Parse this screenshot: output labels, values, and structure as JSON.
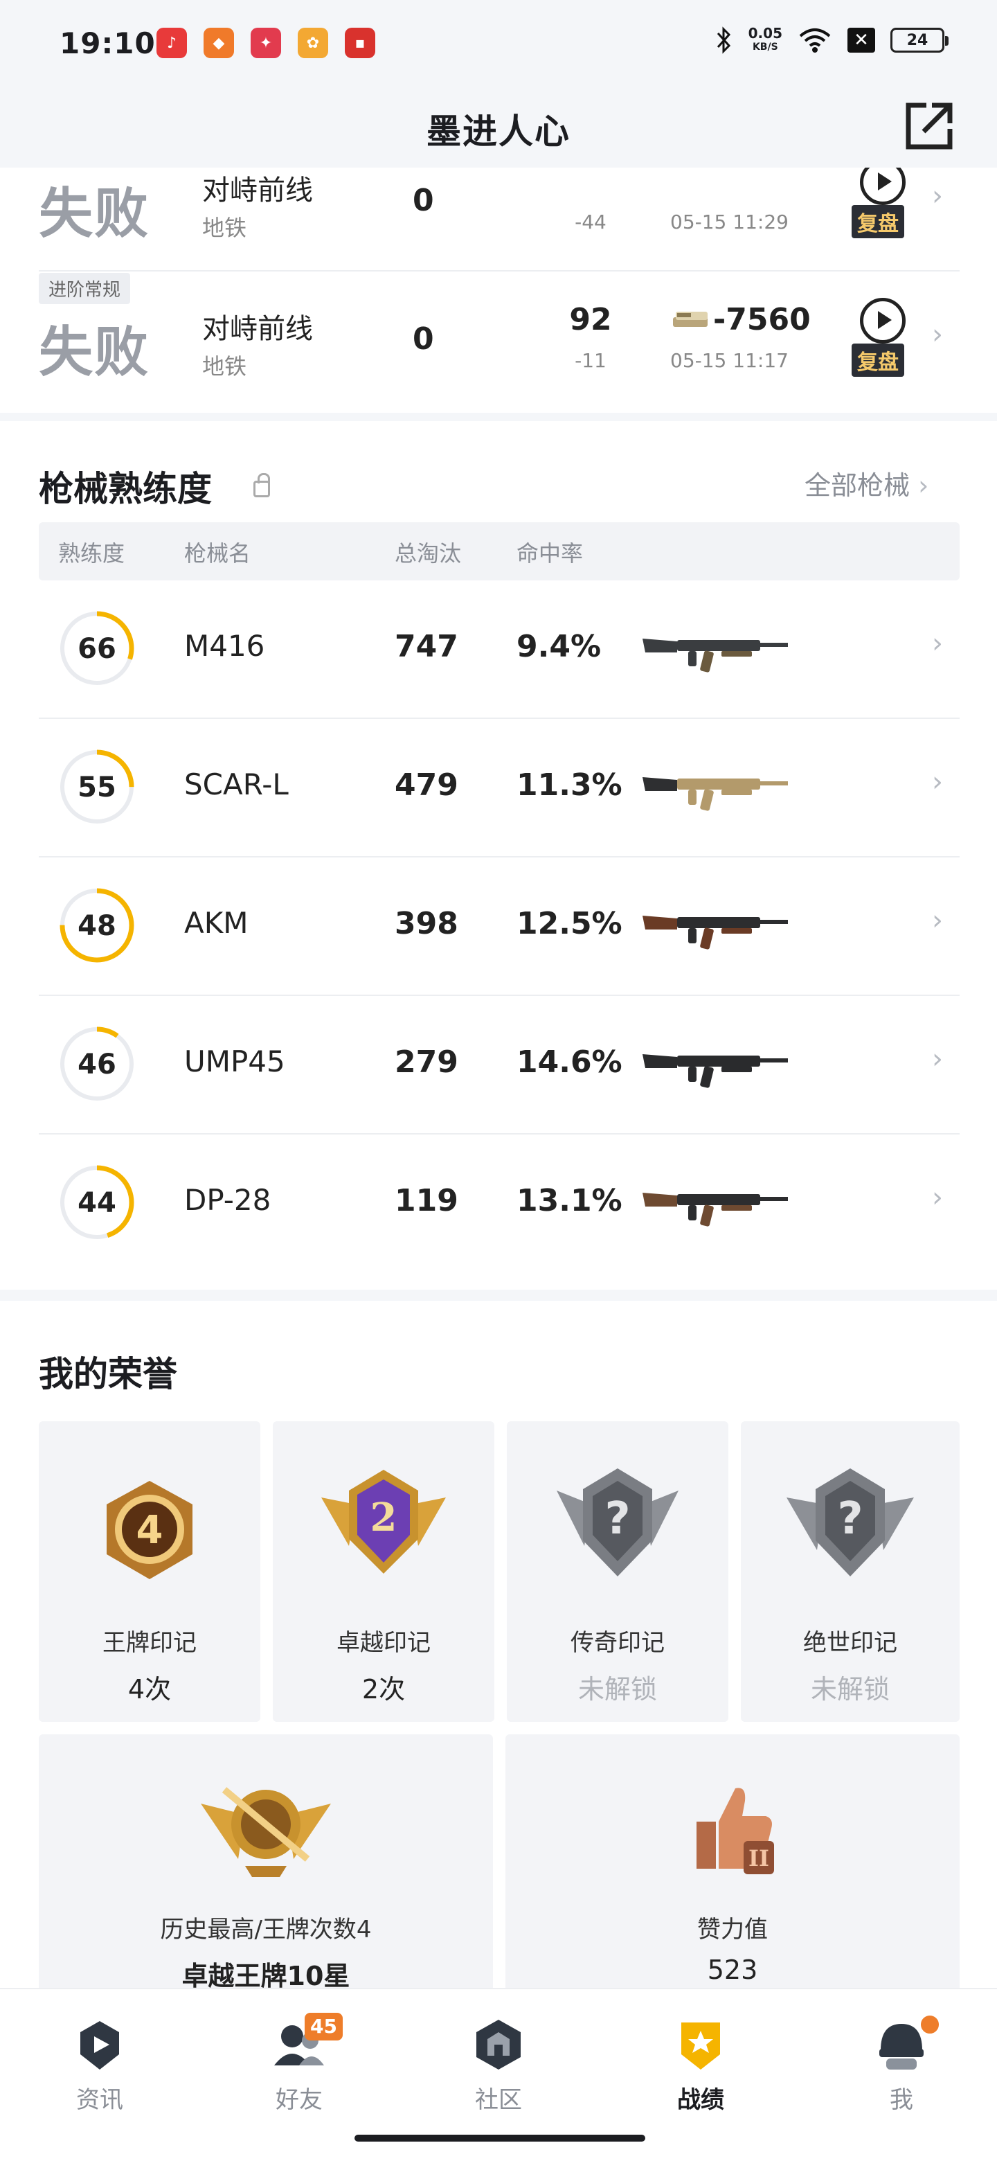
{
  "status_bar": {
    "time": "19:10",
    "speed_value": "0.05",
    "speed_unit": "KB/S",
    "sim": "✕",
    "battery": "24"
  },
  "header": {
    "title": "墨进人心"
  },
  "matches": [
    {
      "tag": "",
      "result": "失败",
      "mode": "对峙前线",
      "map": "地铁",
      "kills": "0",
      "score": "",
      "delta": "-44",
      "coins": "",
      "time": "05-15 11:29",
      "replay_label": "复盘"
    },
    {
      "tag": "进阶常规",
      "result": "失败",
      "mode": "对峙前线",
      "map": "地铁",
      "kills": "0",
      "score": "92",
      "delta": "-11",
      "coins": "-7560",
      "time": "05-15 11:17",
      "replay_label": "复盘"
    }
  ],
  "weapons_section": {
    "title": "枪械熟练度",
    "all_link": "全部枪械",
    "headers": {
      "proficiency": "熟练度",
      "name": "枪械名",
      "kills": "总淘汰",
      "hit_rate": "命中率"
    },
    "rows": [
      {
        "proficiency": "66",
        "level": 0.3,
        "name": "M416",
        "kills": "747",
        "hit_rate": "9.4%",
        "image": "assault-rifle-black"
      },
      {
        "proficiency": "55",
        "level": 0.25,
        "name": "SCAR-L",
        "kills": "479",
        "hit_rate": "11.3%",
        "image": "assault-rifle-tan"
      },
      {
        "proficiency": "48",
        "level": 0.75,
        "name": "AKM",
        "kills": "398",
        "hit_rate": "12.5%",
        "image": "rifle-wood"
      },
      {
        "proficiency": "46",
        "level": 0.1,
        "name": "UMP45",
        "kills": "279",
        "hit_rate": "14.6%",
        "image": "smg-black"
      },
      {
        "proficiency": "44",
        "level": 0.45,
        "name": "DP-28",
        "kills": "119",
        "hit_rate": "13.1%",
        "image": "lmg-wood"
      }
    ]
  },
  "honor_section": {
    "title": "我的荣誉",
    "cards": [
      {
        "label": "王牌印记",
        "value": "4次",
        "badge_text": "4",
        "locked": false
      },
      {
        "label": "卓越印记",
        "value": "2次",
        "badge_text": "2",
        "locked": false
      },
      {
        "label": "传奇印记",
        "value": "未解锁",
        "badge_text": "?",
        "locked": true
      },
      {
        "label": "绝世印记",
        "value": "未解锁",
        "badge_text": "?",
        "locked": true
      }
    ],
    "wide_cards": [
      {
        "label": "历史最高/王牌次数4",
        "value": "卓越王牌10星",
        "badge_text": ""
      },
      {
        "label": "赞力值",
        "value": "523",
        "badge_text": "II"
      }
    ]
  },
  "bottom_nav": [
    {
      "label": "资讯",
      "icon": "news-icon",
      "badge": ""
    },
    {
      "label": "好友",
      "icon": "friends-icon",
      "badge": "45"
    },
    {
      "label": "社区",
      "icon": "community-icon",
      "badge": ""
    },
    {
      "label": "战绩",
      "icon": "record-icon",
      "badge": "",
      "active": true
    },
    {
      "label": "我",
      "icon": "profile-icon",
      "badge": ""
    }
  ],
  "colors": {
    "accent": "#f5b400",
    "ring_track": "#e9ebef",
    "badge_orange": "#ee7d2a"
  }
}
